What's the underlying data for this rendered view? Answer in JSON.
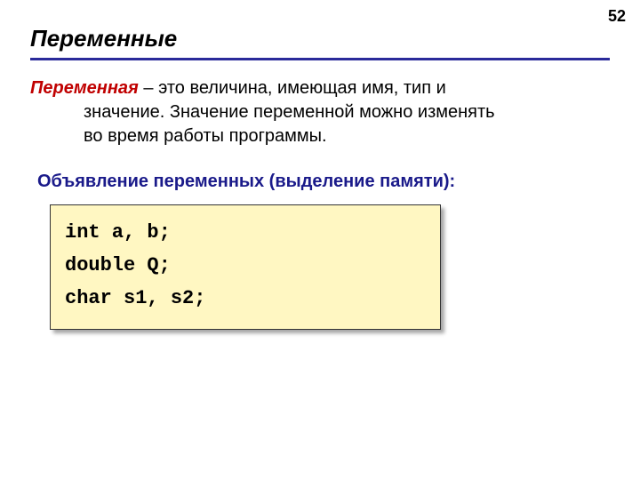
{
  "page_number": "52",
  "title": "Переменные",
  "definition": {
    "term": "Переменная",
    "line1_rest": " – это величина, имеющая имя, тип и",
    "line2": "значение. Значение переменной можно изменять",
    "line3": "во время работы программы."
  },
  "section_label": "Объявление переменных (выделение памяти):",
  "code": {
    "line1": "int a, b;",
    "line2": "double Q;",
    "line3": "char s1, s2;"
  }
}
